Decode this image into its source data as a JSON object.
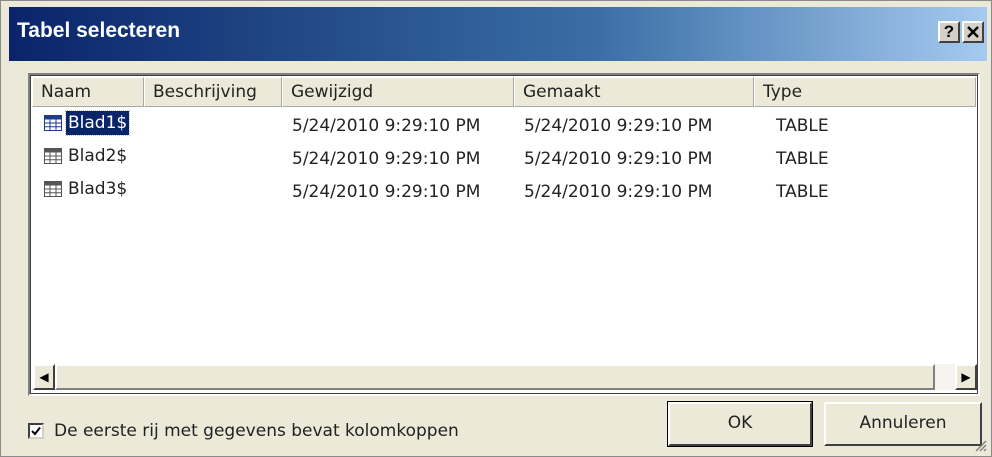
{
  "window": {
    "title": "Tabel selecteren",
    "help_label": "?",
    "close_label": "✕"
  },
  "table": {
    "columns": [
      "Naam",
      "Beschrijving",
      "Gewijzigd",
      "Gemaakt",
      "Type"
    ],
    "rows": [
      {
        "name": "Blad1$",
        "description": "",
        "modified": "5/24/2010 9:29:10 PM",
        "created": "5/24/2010 9:29:10 PM",
        "type": "TABLE",
        "selected": true
      },
      {
        "name": "Blad2$",
        "description": "",
        "modified": "5/24/2010 9:29:10 PM",
        "created": "5/24/2010 9:29:10 PM",
        "type": "TABLE",
        "selected": false
      },
      {
        "name": "Blad3$",
        "description": "",
        "modified": "5/24/2010 9:29:10 PM",
        "created": "5/24/2010 9:29:10 PM",
        "type": "TABLE",
        "selected": false
      }
    ]
  },
  "scrollbar": {
    "left_arrow": "◀",
    "right_arrow": "▶"
  },
  "options": {
    "header_checkbox_label": "De eerste rij met gegevens bevat kolomkoppen",
    "header_checkbox_checked": true
  },
  "buttons": {
    "ok": "OK",
    "cancel": "Annuleren"
  },
  "colors": {
    "titlebar_start": "#0a246a",
    "selection": "#0a246a",
    "dialog_bg": "#ece9d8"
  }
}
